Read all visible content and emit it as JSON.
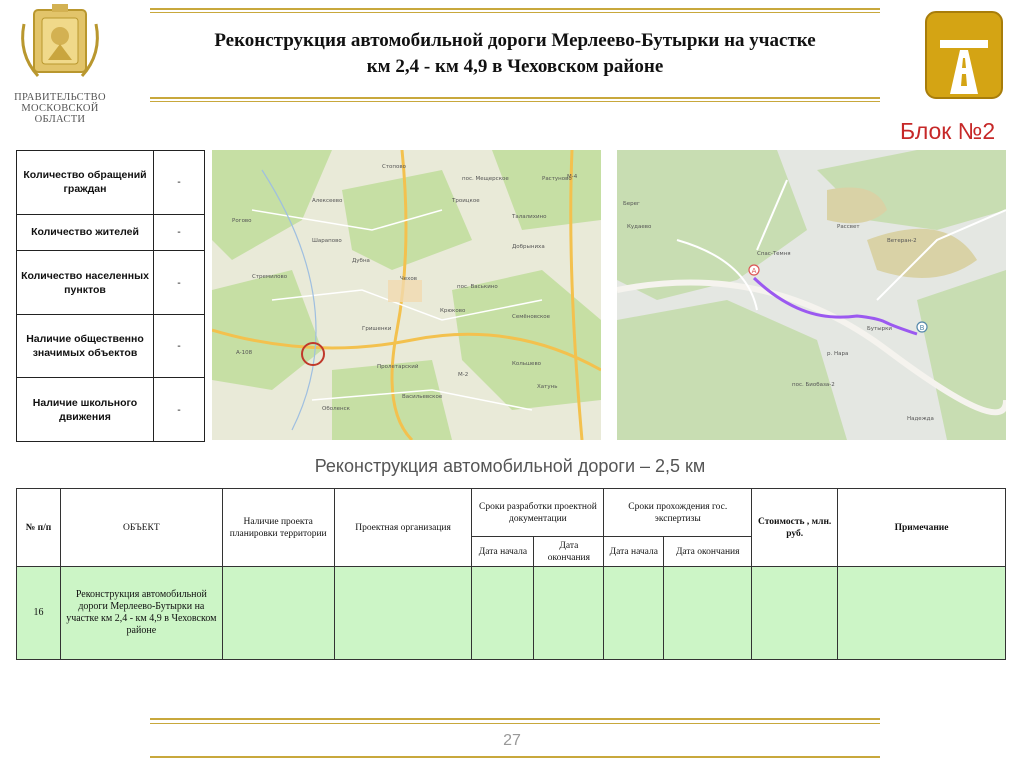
{
  "header": {
    "gov_lines": [
      "ПРАВИТЕЛЬСТВО",
      "МОСКОВСКОЙ",
      "ОБЛАСТИ"
    ],
    "title_line1": "Реконструкция автомобильной дороги Мерлеево-Бутырки на участке",
    "title_line2": "км 2,4 - км 4,9 в Чеховском районе",
    "block_label": "Блок №2"
  },
  "info_table": {
    "rows": [
      {
        "label": "Количество обращений граждан",
        "value": "-"
      },
      {
        "label": "Количество жителей",
        "value": "-"
      },
      {
        "label": "Количество населенных пунктов",
        "value": "-"
      },
      {
        "label": "Наличие общественно значимых объектов",
        "value": "-"
      },
      {
        "label": "Наличие школьного движения",
        "value": "-"
      }
    ]
  },
  "map_left": {
    "labels": [
      "Стопово",
      "пос. Мещерское",
      "Растуново",
      "Алексеево",
      "Троицкое",
      "Рогово",
      "Шарапово",
      "Талалихино",
      "Дубна",
      "Чехов",
      "пос. Васькино",
      "Крюково",
      "Гришенки",
      "Семёновское",
      "Пролетарский",
      "Кольшево",
      "Хатунь",
      "Васильевское",
      "Оболенск",
      "Стремилово",
      "Добрыниха",
      "A-108",
      "M-2",
      "M-4"
    ]
  },
  "map_right": {
    "labels": [
      "Берег",
      "Кудаево",
      "Рассвет",
      "Спас-Темня",
      "Ветеран-2",
      "Бутырки",
      "пос. Биобаза-2",
      "Надежда",
      "р. Нара"
    ],
    "markers": {
      "start": "A",
      "end": "B"
    }
  },
  "subtitle": "Реконструкция автомобильной дороги – 2,5 км",
  "main_table": {
    "headers": {
      "num": "№ п/п",
      "object": "ОБЪЕКТ",
      "planning": "Наличие проекта планировки территории",
      "org": "Проектная организация",
      "dev_terms": "Сроки разработки проектной документации",
      "exp_terms": "Сроки прохождения гос. экспертизы",
      "cost": "Стоимость , млн. руб.",
      "note": "Примечание",
      "start": "Дата начала",
      "end": "Дата окончания",
      "exp_start": "Дата начала",
      "exp_end": "Дата окончания"
    },
    "row": {
      "num": "16",
      "object": "Реконструкция автомобильной дороги Мерлеево-Бутырки на участке км 2,4 - км 4,9 в Чеховском районе",
      "planning": "",
      "org": "",
      "dev_start": "",
      "dev_end": "",
      "exp_start": "",
      "exp_end": "",
      "cost": "",
      "note": ""
    }
  },
  "footer": {
    "page": "27"
  },
  "colors": {
    "gold": "#c8a83c",
    "block_label": "#c62828",
    "row_fill": "#ccf5c6",
    "route": "#9b59f0"
  }
}
